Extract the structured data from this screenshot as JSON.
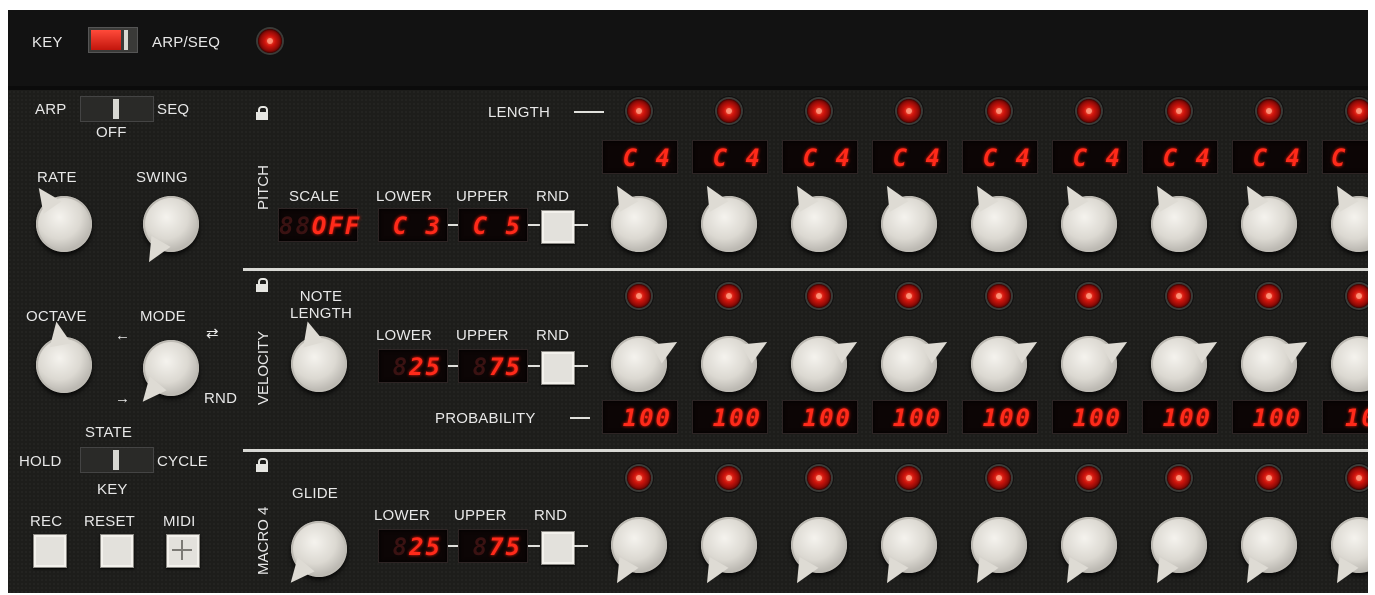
{
  "top": {
    "key_label": "KEY",
    "arpseq_label": "ARP/SEQ"
  },
  "left": {
    "arp": "ARP",
    "seq": "SEQ",
    "off": "OFF",
    "rate": "RATE",
    "swing": "SWING",
    "octave": "OCTAVE",
    "mode": "MODE",
    "rnd": "RND",
    "state": "STATE",
    "hold": "HOLD",
    "cycle": "CYCLE",
    "key": "KEY",
    "rec": "REC",
    "reset": "RESET",
    "midi": "MIDI"
  },
  "pitch": {
    "section_label": "PITCH",
    "length_label": "LENGTH",
    "scale_label": "SCALE",
    "scale_value": "OFF",
    "lower_label": "LOWER",
    "upper_label": "UPPER",
    "rnd_label": "RND",
    "lower_value": "C 3",
    "upper_value": "C 5",
    "steps": [
      "C 4",
      "C 4",
      "C 4",
      "C 4",
      "C 4",
      "C 4",
      "C 4",
      "C 4",
      "C"
    ]
  },
  "velocity": {
    "section_label": "VELOCITY",
    "note_length_label": "NOTE\nLENGTH",
    "lower_label": "LOWER",
    "upper_label": "UPPER",
    "rnd_label": "RND",
    "lower_value": "25",
    "upper_value": "75",
    "probability_label": "PROBABILITY",
    "probability": [
      "100",
      "100",
      "100",
      "100",
      "100",
      "100",
      "100",
      "100",
      "10"
    ]
  },
  "macro": {
    "section_label": "MACRO 4",
    "glide_label": "GLIDE",
    "lower_label": "LOWER",
    "upper_label": "UPPER",
    "rnd_label": "RND",
    "lower_value": "25",
    "upper_value": "75"
  },
  "colors": {
    "panel": "#1d1d1b",
    "led_red": "#d0140c",
    "lcd_text": "#ff2a1a"
  }
}
